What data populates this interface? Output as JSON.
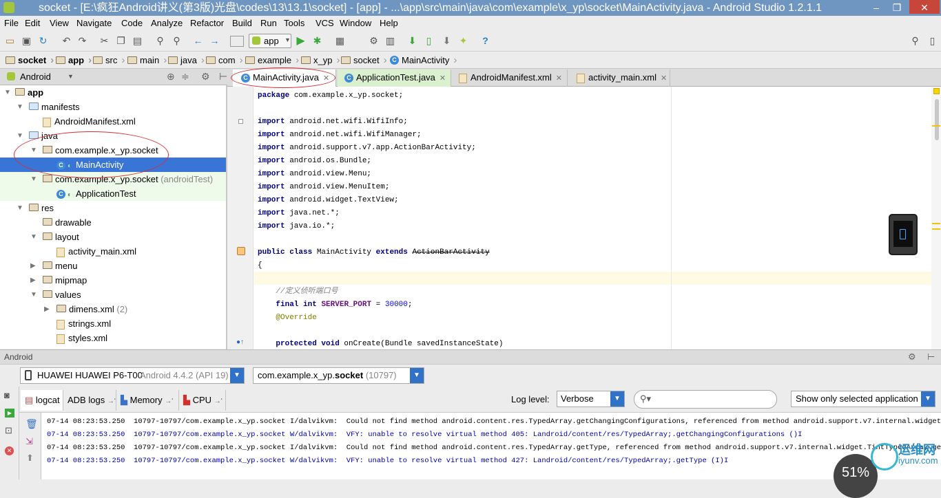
{
  "window": {
    "title": "socket - [E:\\疯狂Android讲义(第3版)光盘\\codes\\13\\13.1\\socket] - [app] - ...\\app\\src\\main\\java\\com\\example\\x_yp\\socket\\MainActivity.java - Android Studio 1.2.1.1",
    "minimize": "–",
    "restore": "❐",
    "close": "✕"
  },
  "menu": [
    "File",
    "Edit",
    "View",
    "Navigate",
    "Code",
    "Analyze",
    "Refactor",
    "Build",
    "Run",
    "Tools",
    "VCS",
    "Window",
    "Help"
  ],
  "toolbar": {
    "run_config": "app",
    "help_icon": "?"
  },
  "breadcrumbs": [
    "socket",
    "app",
    "src",
    "main",
    "java",
    "com",
    "example",
    "x_yp",
    "socket",
    "MainActivity"
  ],
  "project_panel": {
    "view_selector": "Android"
  },
  "tree": [
    {
      "label": "app",
      "level": 0,
      "icon": "module-folder-icon",
      "expanded": true,
      "bold": true
    },
    {
      "label": "manifests",
      "level": 1,
      "icon": "folder-icon",
      "expanded": true
    },
    {
      "label": "AndroidManifest.xml",
      "level": 2,
      "icon": "xml-file-icon"
    },
    {
      "label": "java",
      "level": 1,
      "icon": "folder-icon",
      "expanded": true
    },
    {
      "label": "com.example.x_yp.socket",
      "level": 2,
      "icon": "package-icon",
      "expanded": true
    },
    {
      "label": "MainActivity",
      "level": 3,
      "icon": "class-icon",
      "selected": true
    },
    {
      "label": "com.example.x_yp.socket",
      "suffix": "(androidTest)",
      "level": 2,
      "icon": "package-icon",
      "expanded": true,
      "green": true
    },
    {
      "label": "ApplicationTest",
      "level": 3,
      "icon": "class-icon",
      "green": true
    },
    {
      "label": "res",
      "level": 1,
      "icon": "folder-icon",
      "expanded": true
    },
    {
      "label": "drawable",
      "level": 2,
      "icon": "folder-icon"
    },
    {
      "label": "layout",
      "level": 2,
      "icon": "folder-icon",
      "expanded": true
    },
    {
      "label": "activity_main.xml",
      "level": 3,
      "icon": "xml-file-icon"
    },
    {
      "label": "menu",
      "level": 2,
      "icon": "folder-icon",
      "collapsed": true
    },
    {
      "label": "mipmap",
      "level": 2,
      "icon": "folder-icon",
      "collapsed": true
    },
    {
      "label": "values",
      "level": 2,
      "icon": "folder-icon",
      "expanded": true
    },
    {
      "label": "dimens.xml",
      "suffix": "(2)",
      "level": 3,
      "icon": "folder-icon",
      "collapsed": true
    },
    {
      "label": "strings.xml",
      "level": 3,
      "icon": "xml-file-icon"
    },
    {
      "label": "styles.xml",
      "level": 3,
      "icon": "xml-file-icon"
    }
  ],
  "editor_tabs": [
    {
      "label": "MainActivity.java",
      "active": true
    },
    {
      "label": "ApplicationTest.java",
      "green": true
    },
    {
      "label": "AndroidManifest.xml"
    },
    {
      "label": "activity_main.xml"
    }
  ],
  "code_lines": [
    [
      {
        "t": "package",
        "c": "kw"
      },
      {
        "t": " com.example.x_yp.socket;"
      }
    ],
    [],
    [
      {
        "t": "import",
        "c": "kw"
      },
      {
        "t": " android.net.wifi.WifiInfo;"
      }
    ],
    [
      {
        "t": "import",
        "c": "kw"
      },
      {
        "t": " android.net.wifi.WifiManager;"
      }
    ],
    [
      {
        "t": "import",
        "c": "kw"
      },
      {
        "t": " android.support.v7.app.ActionBarActivity;"
      }
    ],
    [
      {
        "t": "import",
        "c": "kw"
      },
      {
        "t": " android.os.Bundle;"
      }
    ],
    [
      {
        "t": "import",
        "c": "kw"
      },
      {
        "t": " android.view.Menu;"
      }
    ],
    [
      {
        "t": "import",
        "c": "kw"
      },
      {
        "t": " android.view.MenuItem;"
      }
    ],
    [
      {
        "t": "import",
        "c": "kw"
      },
      {
        "t": " android.widget.TextView;"
      }
    ],
    [
      {
        "t": "import",
        "c": "kw"
      },
      {
        "t": " java.net.*;"
      }
    ],
    [
      {
        "t": "import",
        "c": "kw"
      },
      {
        "t": " java.io.*;"
      }
    ],
    [],
    [
      {
        "t": "public class",
        "c": "kw"
      },
      {
        "t": " MainActivity "
      },
      {
        "t": "extends",
        "c": "kw"
      },
      {
        "t": " "
      },
      {
        "t": "ActionBarActivity",
        "c": "strike"
      }
    ],
    [
      {
        "t": "{"
      }
    ],
    [],
    [
      {
        "t": "    "
      },
      {
        "t": "//定义侦听端口号",
        "c": "cmt"
      }
    ],
    [
      {
        "t": "    "
      },
      {
        "t": "final int",
        "c": "kw"
      },
      {
        "t": " "
      },
      {
        "t": "SERVER_PORT",
        "c": "fld"
      },
      {
        "t": " = "
      },
      {
        "t": "30000",
        "c": "num"
      },
      {
        "t": ";"
      }
    ],
    [
      {
        "t": "    "
      },
      {
        "t": "@Override",
        "c": "ann"
      }
    ],
    [],
    [
      {
        "t": "    "
      },
      {
        "t": "protected void",
        "c": "kw"
      },
      {
        "t": " onCreate(Bundle savedInstanceState)"
      }
    ]
  ],
  "android_panel": {
    "title": "Android",
    "device": "HUAWEI HUAWEI P6-T00",
    "device_os": "Android 4.4.2 (API 19)",
    "process": "com.example.x_yp.",
    "process_bold": "socket",
    "process_pid": "(10797)",
    "tabs": [
      "logcat",
      "ADB logs",
      "Memory",
      "CPU"
    ],
    "log_level_label": "Log level:",
    "log_level": "Verbose",
    "search_placeholder": "",
    "filter": "Show only selected application"
  },
  "log_lines": [
    {
      "text": "07-14 08:23:53.250  10797-10797/com.example.x_yp.socket I/dalvikvm:  Could not find method android.content.res.TypedArray.getChangingConfigurations, referenced from method android.support.v7.internal.widget.TintTyp",
      "level": "info"
    },
    {
      "text": "07-14 08:23:53.250  10797-10797/com.example.x_yp.socket W/dalvikvm:  VFY: unable to resolve virtual method 405: Landroid/content/res/TypedArray;.getChangingConfigurations ()I",
      "level": "warn"
    },
    {
      "text": "07-14 08:23:53.250  10797-10797/com.example.x_yp.socket I/dalvikvm:  Could not find method android.content.res.TypedArray.getType, referenced from method android.support.v7.internal.widget.TintTypedArray.getType",
      "level": "info"
    },
    {
      "text": "07-14 08:23:53.250  10797-10797/com.example.x_yp.socket W/dalvikvm:  VFY: unable to resolve virtual method 427: Landroid/content/res/TypedArray;.getType (I)I",
      "level": "warn"
    }
  ],
  "watermark": {
    "cn": "运维网",
    "domain": "iyunv.com",
    "percent": "51"
  },
  "colors": {
    "titlebar": "#6f95c1",
    "selection": "#3875d7",
    "annotation_circle": "#d83030",
    "combo_accent": "#2f72c8",
    "keyword": "#000080",
    "log_warn": "#0000aa"
  }
}
